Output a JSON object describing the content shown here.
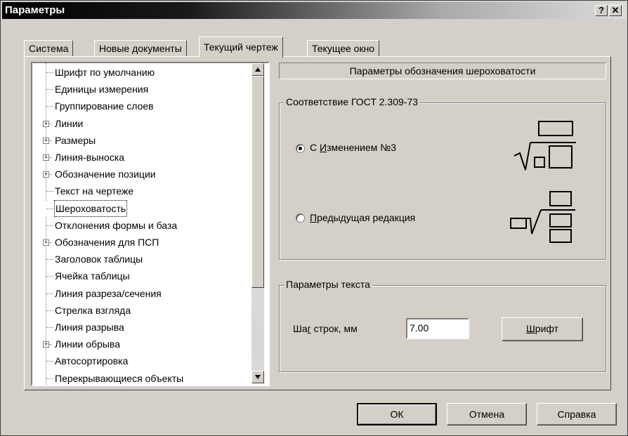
{
  "window": {
    "title": "Параметры",
    "help_btn": "?",
    "close_btn": "✕"
  },
  "tabs": [
    {
      "label": "Система"
    },
    {
      "label": "Новые документы"
    },
    {
      "label": "Текущий чертеж"
    },
    {
      "label": "Текущее окно"
    }
  ],
  "tree": {
    "items": [
      {
        "label": "Шрифт по умолчанию",
        "expandable": false
      },
      {
        "label": "Единицы измерения",
        "expandable": false
      },
      {
        "label": "Группирование слоев",
        "expandable": false
      },
      {
        "label": "Линии",
        "expandable": true
      },
      {
        "label": "Размеры",
        "expandable": true
      },
      {
        "label": "Линия-выноска",
        "expandable": true
      },
      {
        "label": "Обозначение позиции",
        "expandable": true
      },
      {
        "label": "Текст на чертеже",
        "expandable": false
      },
      {
        "label": "Шероховатость",
        "expandable": false,
        "selected": true
      },
      {
        "label": "Отклонения формы и база",
        "expandable": false
      },
      {
        "label": "Обозначения для ПСП",
        "expandable": true
      },
      {
        "label": "Заголовок таблицы",
        "expandable": false
      },
      {
        "label": "Ячейка таблицы",
        "expandable": false
      },
      {
        "label": "Линия разреза/сечения",
        "expandable": false
      },
      {
        "label": "Стрелка взгляда",
        "expandable": false
      },
      {
        "label": "Линия разрыва",
        "expandable": false
      },
      {
        "label": "Линии обрыва",
        "expandable": true
      },
      {
        "label": "Автосортировка",
        "expandable": false
      },
      {
        "label": "Перекрывающиеся объекты",
        "expandable": false
      }
    ]
  },
  "right": {
    "header": "Параметры обозначения шероховатости",
    "gost_group": {
      "legend": "Соответствие ГОСТ 2.309-73",
      "option1": {
        "pre": "С ",
        "underline": "И",
        "post": "зменением №3",
        "checked": true
      },
      "option2": {
        "pre": "",
        "underline": "П",
        "post": "редыдущая редакция",
        "checked": false
      }
    },
    "text_group": {
      "legend": "Параметры текста",
      "line_step_pre": "Ша",
      "line_step_underline": "г",
      "line_step_post": " строк, мм",
      "line_step_value": "7.00",
      "font_btn_underline": "Ш",
      "font_btn_post": "рифт"
    }
  },
  "footer": {
    "ok": "ОК",
    "cancel": "Отмена",
    "help": "Справка"
  }
}
